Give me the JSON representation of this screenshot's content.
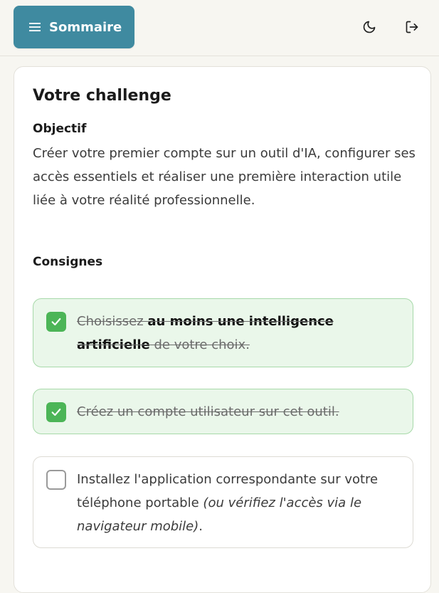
{
  "header": {
    "menu_label": "Sommaire",
    "menu_icon": "hamburger-icon",
    "theme_icon": "moon-icon",
    "logout_icon": "logout-icon"
  },
  "card": {
    "title": "Votre challenge",
    "objective_label": "Objectif",
    "objective_text": "Créer votre premier compte sur un outil d'IA, configurer ses accès essentiels et réaliser une première interaction utile liée à votre réalité professionnelle.",
    "instructions_label": "Consignes"
  },
  "tasks": [
    {
      "checked": true,
      "part1": "Choisissez ",
      "bold": "au moins une intelligence artificielle",
      "part2": " de votre choix."
    },
    {
      "checked": true,
      "text": "Créez un compte utilisateur sur cet outil."
    },
    {
      "checked": false,
      "text": "Installez l'application correspondante sur votre téléphone portable ",
      "italic": "(ou vérifiez l'accès via le navigateur mobile)",
      "end": "."
    }
  ],
  "colors": {
    "accent": "#3f8aa0",
    "done_bg": "#eaf7ea",
    "done_border": "#a7d9a9",
    "check_green": "#4cb557"
  }
}
